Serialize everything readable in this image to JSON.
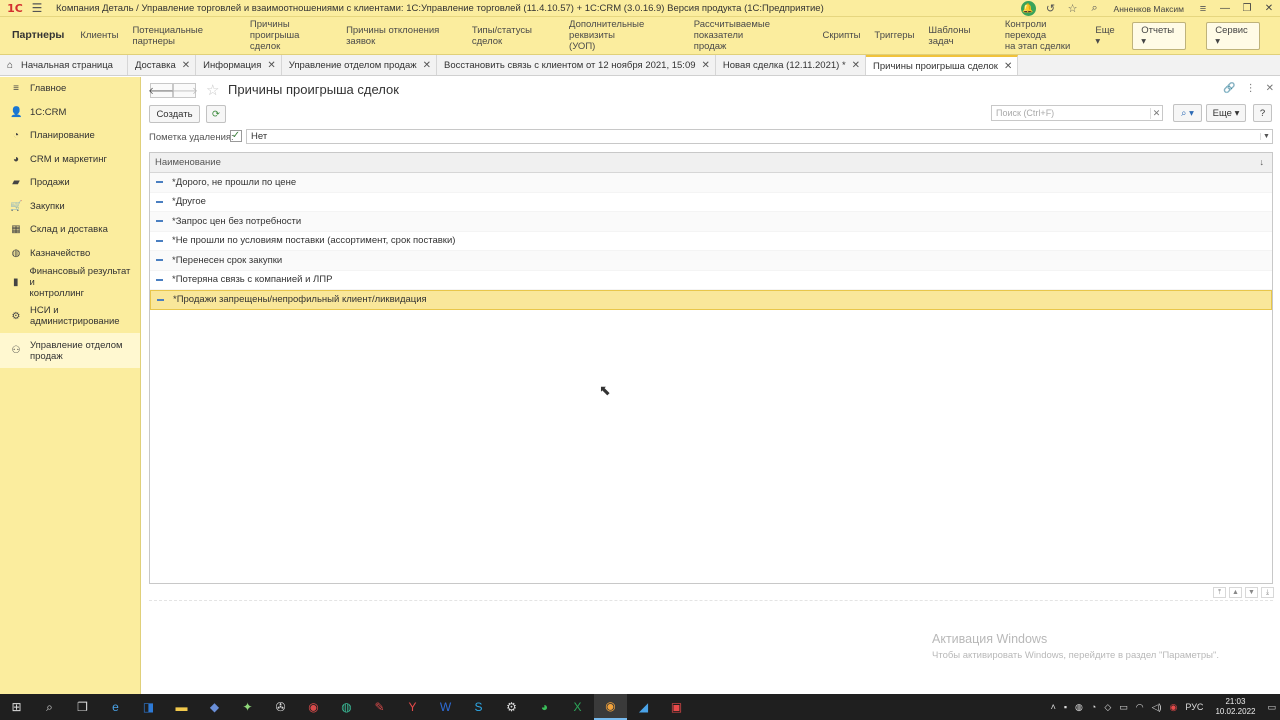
{
  "titlebar": {
    "logo": "1С",
    "title": "Компания Деталь / Управление торговлей и взаимоотношениями с клиентами: 1С:Управление торговлей (11.4.10.57) + 1С:CRM (3.0.16.9) Версия продукта  (1С:Предприятие)",
    "user": "Анненков Максим"
  },
  "nav": {
    "items": [
      {
        "label": "Партнеры",
        "active": true
      },
      {
        "label": "Клиенты"
      },
      {
        "label": "Потенциальные партнеры"
      },
      {
        "label": "Причины проигрыша\nсделок"
      },
      {
        "label": "Причины отклонения заявок"
      },
      {
        "label": "Типы/статусы сделок"
      },
      {
        "label": "Дополнительные реквизиты\n(УОП)"
      },
      {
        "label": "Рассчитываемые показатели\nпродаж"
      },
      {
        "label": "Скрипты"
      },
      {
        "label": "Триггеры"
      },
      {
        "label": "Шаблоны задач"
      },
      {
        "label": "Контроли перехода\nна этап сделки"
      },
      {
        "label": "Еще ▾"
      }
    ],
    "reports": "Отчеты ▾",
    "service": "Сервис ▾"
  },
  "tabs": [
    {
      "label": "Начальная страница",
      "home": true,
      "closable": false
    },
    {
      "label": "Доставка",
      "closable": true
    },
    {
      "label": "Информация",
      "closable": true
    },
    {
      "label": "Управление отделом продаж",
      "closable": true
    },
    {
      "label": "Восстановить связь с клиентом от 12 ноября 2021, 15:09",
      "closable": true
    },
    {
      "label": "Новая сделка (12.11.2021) *",
      "closable": true
    },
    {
      "label": "Причины проигрыша сделок",
      "closable": true,
      "active": true
    }
  ],
  "sidebar": {
    "items": [
      {
        "label": "Главное",
        "icon": "≡"
      },
      {
        "label": "1С:CRM",
        "icon": "👤"
      },
      {
        "label": "Планирование",
        "icon": "◔"
      },
      {
        "label": "CRM и маркетинг",
        "icon": "◕"
      },
      {
        "label": "Продажи",
        "icon": "▰"
      },
      {
        "label": "Закупки",
        "icon": "🛒"
      },
      {
        "label": "Склад и доставка",
        "icon": "▦"
      },
      {
        "label": "Казначейство",
        "icon": "◍"
      },
      {
        "label": "Финансовый результат и\nконтроллинг",
        "icon": "▮"
      },
      {
        "label": "НСИ и\nадминистрирование",
        "icon": "⚙"
      },
      {
        "label": "Управление отделом\nпродаж",
        "icon": "⚇",
        "active": true
      }
    ]
  },
  "form": {
    "title": "Причины проигрыша сделок",
    "create_label": "Создать",
    "search_placeholder": "Поиск (Ctrl+F)",
    "more_label": "Еще ▾",
    "help_label": "?",
    "filter_label": "Пометка удаления:",
    "filter_value": "Нет",
    "column_header": "Наименование",
    "rows": [
      {
        "name": "*Дорого, не прошли по цене"
      },
      {
        "name": "*Другое"
      },
      {
        "name": "*Запрос цен без потребности"
      },
      {
        "name": "*Не прошли по условиям поставки (ассортимент, срок поставки)"
      },
      {
        "name": "*Перенесен срок закупки"
      },
      {
        "name": "*Потеряна связь с компанией и ЛПР"
      },
      {
        "name": "*Продажи запрещены/непрофильный клиент/ликвидация",
        "selected": true
      }
    ]
  },
  "activation": {
    "line1": "Активация Windows",
    "line2": "Чтобы активировать Windows, перейдите в раздел \"Параметры\"."
  },
  "taskbar": {
    "lang": "РУС",
    "time": "21:03",
    "date": "10.02.2022"
  },
  "colors": {
    "panel": "#fbed9e",
    "selected_row": "#f9e79a",
    "active_tab_accent": "#f0c23b"
  }
}
